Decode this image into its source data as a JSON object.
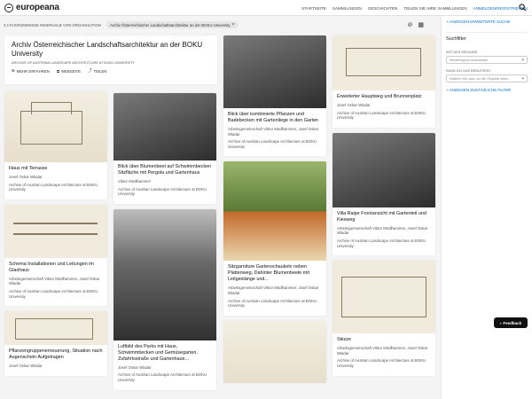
{
  "header": {
    "logo": "europeana",
    "nav": [
      "STARTSEITE",
      "SAMMLUNGEN",
      "GESCHICHTEN",
      "TEILEN SIE IHRE SAMMLUNGEN"
    ],
    "login": "ANMELDEN/REGISTRIEREN"
  },
  "results": {
    "count": "3.170 ERGEBNISSE INNERHALB VON ORGANISATION",
    "chip": "Archiv Österreichischer Landschaftsarchitektur an der BOKU University"
  },
  "org": {
    "title": "Archiv Österreichischer Landschaftsarchitektur an der BOKU University",
    "subtitle": "ARCHIVE OF AUSTRIAN LANDSCAPE ARCHITECTURE AT BOKU UNIVERSITY",
    "buttons": [
      "MEHR ERFAHREN",
      "WEBSEITE",
      "TEILEN"
    ]
  },
  "sidebar": {
    "advanced": "+ ANZEIGEN ERWEITERTE SUCHE",
    "filter_title": "Suchfilter",
    "media_label": "ART DES MEDIUMS",
    "media_placeholder": "Medientypen auswählen",
    "reuse_label": "KANN ICH DAS BENUTZEN?",
    "reuse_placeholder": "Wählen Sie aus, ob die Objekte wied...",
    "more": "+ ANZEIGEN ZUSÄTZLICHE FILTER"
  },
  "feedback": "Feedback",
  "cards": [
    {
      "title": "Haus mit Terrasse",
      "creator": "Josef Oskar Wladar",
      "provider": "Archive of Austrian Landscape Architecture at BOKU University"
    },
    {
      "title": "Schema Installationen und Leitungen im Glashaus",
      "creator": "Arbeitsgemeinschaft Viktor Mödlhammer, Josef Oskar Wladar",
      "provider": "Archive of Austrian Landscape Architecture at BOKU University"
    },
    {
      "title": "Pflanzengruppenerneuerung, Situation nach Augenschein Aufgetragen",
      "creator": "Josef Oskar Wladar",
      "provider": ""
    },
    {
      "title": "Blick über Blumenbeet auf Schwimmbecken Sitzfläche mit Pergola und Gartenhaus",
      "creator": "Viktor Mödlhammer",
      "provider": "Archive of Austrian Landscape Architecture at BOKU University"
    },
    {
      "title": "Luftbild des Parks mit Haus, Schwimmbecken und Gemüsegarten, Zufahrtsstraße und Gartenhaue...",
      "creator": "Josef Oskar Wladar",
      "provider": "Archive of Austrian Landscape Architecture at BOKU University"
    },
    {
      "title": "Blick über kombinierte Pflanzen und Badebecken mit Gartenliege in den Garten",
      "creator": "Arbeitsgemeinschaft Viktor Mödlhammer, Josef Oskar Wladar",
      "provider": "Archive of Austrian Landscape Architecture at BOKU University"
    },
    {
      "title": "Sitzgarniture Gartenschaukeln neben Plattenweg, Dahinter Blumenbeete mit Leitgestänge und...",
      "creator": "Arbeitsgemeinschaft Viktor Mödlhammer, Josef Oskar Wladar",
      "provider": "Archive of Austrian Landscape Architecture at BOKU University"
    },
    {
      "title": "Erweiterter Hauptweg und Brunnenplatz",
      "creator": "Josef Oskar Wladar",
      "provider": "Archive of Austrian Landscape Architecture at BOKU University"
    },
    {
      "title": "Villa Raipe Frontansicht mit Gartenteil und Kiesweg",
      "creator": "Arbeitsgemeinschaft Viktor Mödlhammer, Josef Oskar Wladar",
      "provider": "Archive of Austrian Landscape Architecture at BOKU University"
    },
    {
      "title": "Skizze",
      "creator": "Arbeitsgemeinschaft Viktor Mödlhammer, Josef Oskar Wladar",
      "provider": "Archive of Austrian Landscape Architecture at BOKU University"
    }
  ],
  "colors": {
    "accent": "#0a72cc",
    "dark": "#111111"
  }
}
